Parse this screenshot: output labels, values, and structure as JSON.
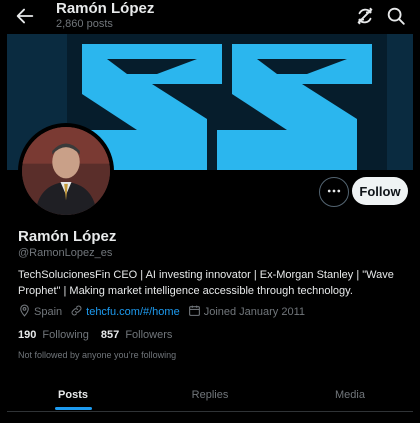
{
  "header": {
    "title": "Ramón López",
    "subtitle": "2,860 posts",
    "back_icon": "back-arrow-icon",
    "refresh_icon": "refresh-icon",
    "search_icon": "search-icon"
  },
  "colors": {
    "background": "#000000",
    "accent": "#1d9bf0",
    "banner_bg": "#0a3d5c",
    "banner_shape": "#2bb6ee",
    "muted_text": "#71767b",
    "primary_text": "#e7e9ea"
  },
  "profile": {
    "name": "Ramón López",
    "handle": "@RamonLopez_es",
    "bio": "TechSolucionesFin CEO | AI investing innovator | Ex-Morgan Stanley | \"Wave Prophet\" | Making market intelligence accessible through technology.",
    "location": "Spain",
    "website": "tehcfu.com/#/home",
    "joined": "Joined January 2011",
    "following_count": "190",
    "following_label": "Following",
    "followers_count": "857",
    "followers_label": "Followers",
    "not_followed_text": "Not followed by anyone you’re following"
  },
  "actions": {
    "more_icon": "more-dots-icon",
    "follow_label": "Follow"
  },
  "tabs": [
    {
      "label": "Posts",
      "active": true
    },
    {
      "label": "Replies",
      "active": false
    },
    {
      "label": "Media",
      "active": false
    }
  ]
}
